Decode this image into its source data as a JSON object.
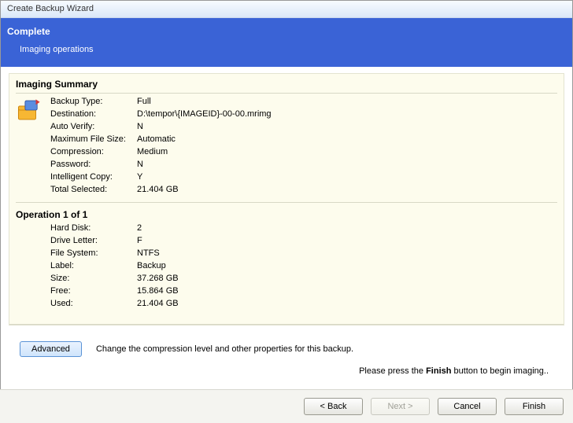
{
  "window": {
    "title": "Create Backup Wizard"
  },
  "header": {
    "title": "Complete",
    "subtitle": "Imaging operations"
  },
  "summary": {
    "title": "Imaging Summary",
    "rows": [
      {
        "label": "Backup Type:",
        "value": "Full"
      },
      {
        "label": "Destination:",
        "value": "D:\\tempor\\{IMAGEID}-00-00.mrimg"
      },
      {
        "label": "Auto Verify:",
        "value": "N"
      },
      {
        "label": "Maximum File Size:",
        "value": "Automatic"
      },
      {
        "label": "Compression:",
        "value": "Medium"
      },
      {
        "label": "Password:",
        "value": "N"
      },
      {
        "label": "Intelligent Copy:",
        "value": "Y"
      },
      {
        "label": "Total Selected:",
        "value": "21.404 GB"
      }
    ]
  },
  "operation": {
    "title": "Operation 1 of 1",
    "rows": [
      {
        "label": "Hard Disk:",
        "value": "2"
      },
      {
        "label": "Drive Letter:",
        "value": "F"
      },
      {
        "label": "File System:",
        "value": "NTFS"
      },
      {
        "label": "Label:",
        "value": "Backup"
      },
      {
        "label": "Size:",
        "value": "37.268 GB"
      },
      {
        "label": "Free:",
        "value": "15.864 GB"
      },
      {
        "label": "Used:",
        "value": "21.404 GB"
      }
    ]
  },
  "advanced": {
    "button": "Advanced",
    "hint": "Change the compression level and other properties for this backup."
  },
  "press_hint": {
    "pre": "Please press the ",
    "bold": "Finish",
    "post": "  button to begin imaging.."
  },
  "footer": {
    "back": "< Back",
    "next": "Next >",
    "cancel": "Cancel",
    "finish": "Finish"
  }
}
